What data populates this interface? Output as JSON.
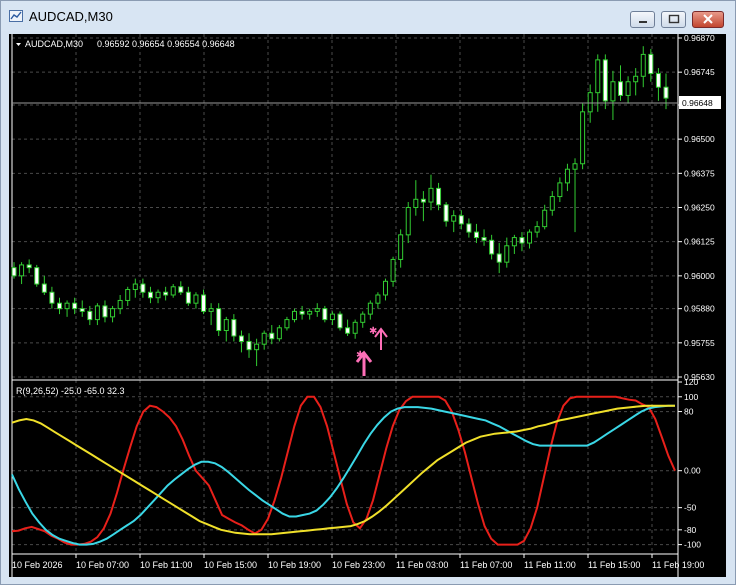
{
  "window": {
    "title": "AUDCAD,M30"
  },
  "colors": {
    "background": "#000000",
    "grid": "#4a4a4a",
    "candle": "#32cd32",
    "text": "#ffffff",
    "red_line": "#e8201a",
    "cyan_line": "#3ad7e6",
    "yellow_line": "#f0e02a",
    "arrow": "#ff6fb8"
  },
  "main_chart": {
    "symbol_label": "AUDCAD,M30",
    "ohlc_label": "0.96592 0.96654 0.96554 0.96648",
    "current_price": "0.96648",
    "price_ticks": [
      "0.96870",
      "0.96745",
      "0.96625",
      "0.96500",
      "0.96375",
      "0.96250",
      "0.96125",
      "0.96000",
      "0.95880",
      "0.95755",
      "0.95630"
    ]
  },
  "indicator": {
    "label": "R(9,26,52) -25.0 -65.0 32.3",
    "ticks": [
      "120",
      "100",
      "80",
      "0.00",
      "-50",
      "-80",
      "-100"
    ]
  },
  "time_axis": [
    "10 Feb 2026",
    "10 Feb 07:00",
    "10 Feb 11:00",
    "10 Feb 15:00",
    "10 Feb 19:00",
    "10 Feb 23:00",
    "11 Feb 03:00",
    "11 Feb 07:00",
    "11 Feb 11:00",
    "11 Feb 15:00",
    "11 Feb 19:00"
  ],
  "chart_data": {
    "type": "line",
    "title": "AUDCAD,M30",
    "ylim": [
      0.9563,
      0.9687
    ],
    "candles": [
      [
        0.9603,
        0.9605,
        0.9599,
        0.96
      ],
      [
        0.96,
        0.9605,
        0.9597,
        0.9604
      ],
      [
        0.9604,
        0.9606,
        0.9601,
        0.9603
      ],
      [
        0.9603,
        0.9604,
        0.9596,
        0.9597
      ],
      [
        0.9597,
        0.96,
        0.9593,
        0.9594
      ],
      [
        0.9594,
        0.9596,
        0.9588,
        0.959
      ],
      [
        0.959,
        0.9592,
        0.9586,
        0.9588
      ],
      [
        0.9588,
        0.9591,
        0.9585,
        0.959
      ],
      [
        0.959,
        0.9592,
        0.9586,
        0.9588
      ],
      [
        0.9588,
        0.9591,
        0.9585,
        0.9587
      ],
      [
        0.9587,
        0.9589,
        0.9582,
        0.9584
      ],
      [
        0.9584,
        0.959,
        0.9582,
        0.9589
      ],
      [
        0.9589,
        0.9591,
        0.9583,
        0.9585
      ],
      [
        0.9585,
        0.9589,
        0.9583,
        0.9588
      ],
      [
        0.9588,
        0.9593,
        0.9586,
        0.9591
      ],
      [
        0.9591,
        0.9596,
        0.9589,
        0.9595
      ],
      [
        0.9595,
        0.9599,
        0.9592,
        0.9597
      ],
      [
        0.9597,
        0.9599,
        0.9592,
        0.9594
      ],
      [
        0.9594,
        0.9596,
        0.959,
        0.9592
      ],
      [
        0.9592,
        0.9595,
        0.959,
        0.9594
      ],
      [
        0.9594,
        0.9596,
        0.9591,
        0.9593
      ],
      [
        0.9593,
        0.9597,
        0.9592,
        0.9596
      ],
      [
        0.9596,
        0.9598,
        0.9593,
        0.9594
      ],
      [
        0.9594,
        0.9596,
        0.9589,
        0.959
      ],
      [
        0.959,
        0.9594,
        0.9588,
        0.9593
      ],
      [
        0.9593,
        0.9595,
        0.9586,
        0.9587
      ],
      [
        0.9587,
        0.959,
        0.9582,
        0.9588
      ],
      [
        0.9588,
        0.959,
        0.9578,
        0.958
      ],
      [
        0.958,
        0.9585,
        0.9576,
        0.9584
      ],
      [
        0.9584,
        0.9586,
        0.9576,
        0.9578
      ],
      [
        0.9578,
        0.958,
        0.9572,
        0.9576
      ],
      [
        0.9576,
        0.9579,
        0.957,
        0.9573
      ],
      [
        0.9573,
        0.9577,
        0.9567,
        0.9575
      ],
      [
        0.9575,
        0.958,
        0.9573,
        0.9579
      ],
      [
        0.9579,
        0.9582,
        0.9575,
        0.9577
      ],
      [
        0.9577,
        0.9582,
        0.9576,
        0.9581
      ],
      [
        0.9581,
        0.9585,
        0.958,
        0.9584
      ],
      [
        0.9584,
        0.9588,
        0.9583,
        0.9587
      ],
      [
        0.9587,
        0.9589,
        0.9584,
        0.9586
      ],
      [
        0.9586,
        0.9588,
        0.9584,
        0.9587
      ],
      [
        0.9587,
        0.959,
        0.9585,
        0.9588
      ],
      [
        0.9588,
        0.9589,
        0.9583,
        0.9584
      ],
      [
        0.9584,
        0.9587,
        0.9582,
        0.9586
      ],
      [
        0.9586,
        0.9587,
        0.958,
        0.9581
      ],
      [
        0.9581,
        0.9584,
        0.9578,
        0.9579
      ],
      [
        0.9579,
        0.9584,
        0.9577,
        0.9583
      ],
      [
        0.9583,
        0.9587,
        0.9581,
        0.9586
      ],
      [
        0.9586,
        0.9591,
        0.9584,
        0.959
      ],
      [
        0.959,
        0.9594,
        0.9588,
        0.9593
      ],
      [
        0.9593,
        0.9599,
        0.9591,
        0.9598
      ],
      [
        0.9598,
        0.9607,
        0.9596,
        0.9606
      ],
      [
        0.9606,
        0.9617,
        0.9603,
        0.9615
      ],
      [
        0.9615,
        0.9627,
        0.9612,
        0.9625
      ],
      [
        0.9625,
        0.9635,
        0.9622,
        0.9628
      ],
      [
        0.9628,
        0.9631,
        0.962,
        0.9627
      ],
      [
        0.9627,
        0.9637,
        0.9624,
        0.9632
      ],
      [
        0.9632,
        0.9634,
        0.9624,
        0.9626
      ],
      [
        0.9626,
        0.9627,
        0.9618,
        0.962
      ],
      [
        0.962,
        0.9624,
        0.9616,
        0.9622
      ],
      [
        0.9622,
        0.9624,
        0.9617,
        0.9619
      ],
      [
        0.9619,
        0.9621,
        0.9614,
        0.9616
      ],
      [
        0.9616,
        0.9619,
        0.9612,
        0.9614
      ],
      [
        0.9614,
        0.9617,
        0.9611,
        0.9613
      ],
      [
        0.9613,
        0.9615,
        0.9606,
        0.9608
      ],
      [
        0.9608,
        0.9612,
        0.9601,
        0.9605
      ],
      [
        0.9605,
        0.9614,
        0.9603,
        0.9611
      ],
      [
        0.9611,
        0.9615,
        0.9608,
        0.9614
      ],
      [
        0.9614,
        0.9616,
        0.9609,
        0.9612
      ],
      [
        0.9612,
        0.9617,
        0.961,
        0.9616
      ],
      [
        0.9616,
        0.962,
        0.9614,
        0.9618
      ],
      [
        0.9618,
        0.9626,
        0.9617,
        0.9624
      ],
      [
        0.9624,
        0.9631,
        0.9622,
        0.9629
      ],
      [
        0.9629,
        0.9636,
        0.9627,
        0.9634
      ],
      [
        0.9634,
        0.9641,
        0.9631,
        0.9639
      ],
      [
        0.9639,
        0.9643,
        0.9616,
        0.9641
      ],
      [
        0.9641,
        0.9663,
        0.9639,
        0.966
      ],
      [
        0.966,
        0.967,
        0.9656,
        0.9667
      ],
      [
        0.9667,
        0.9681,
        0.966,
        0.9679
      ],
      [
        0.9679,
        0.9681,
        0.9661,
        0.9664
      ],
      [
        0.9664,
        0.9675,
        0.9657,
        0.9671
      ],
      [
        0.9671,
        0.9677,
        0.9664,
        0.9666
      ],
      [
        0.9666,
        0.9673,
        0.9663,
        0.9671
      ],
      [
        0.9671,
        0.9676,
        0.9666,
        0.9673
      ],
      [
        0.9673,
        0.9684,
        0.9669,
        0.9681
      ],
      [
        0.9681,
        0.9683,
        0.9671,
        0.9674
      ],
      [
        0.9674,
        0.9676,
        0.9664,
        0.9669
      ],
      [
        0.9669,
        0.9674,
        0.9661,
        0.9665
      ]
    ],
    "indicator_ylim": [
      -110,
      120
    ],
    "series": [
      {
        "color": "red",
        "values": [
          -82,
          -81,
          -78,
          -76,
          -79,
          -82,
          -88,
          -92,
          -97,
          -100,
          -100,
          -99,
          -96,
          -90,
          -78,
          -58,
          -30,
          2,
          32,
          60,
          80,
          88,
          86,
          80,
          72,
          60,
          42,
          20,
          0,
          -10,
          -20,
          -40,
          -60,
          -65,
          -70,
          -74,
          -80,
          -85,
          -80,
          -65,
          -40,
          -10,
          25,
          60,
          88,
          100,
          100,
          86,
          60,
          25,
          -10,
          -45,
          -70,
          -78,
          -65,
          -40,
          -5,
          30,
          60,
          82,
          94,
          100,
          100,
          100,
          100,
          100,
          95,
          80,
          55,
          25,
          -10,
          -45,
          -75,
          -92,
          -100,
          -100,
          -100,
          -100,
          -95,
          -78,
          -50,
          -10,
          30,
          65,
          88,
          98,
          100,
          100,
          100,
          100,
          100,
          100,
          100,
          98,
          96,
          95,
          90,
          86,
          70,
          45,
          20,
          0
        ]
      },
      {
        "color": "cyan",
        "values": [
          -5,
          -25,
          -42,
          -58,
          -70,
          -80,
          -87,
          -92,
          -95,
          -98,
          -100,
          -100,
          -99,
          -96,
          -92,
          -86,
          -80,
          -74,
          -68,
          -60,
          -50,
          -40,
          -30,
          -20,
          -12,
          -5,
          2,
          8,
          12,
          12,
          10,
          5,
          -2,
          -10,
          -18,
          -26,
          -33,
          -40,
          -46,
          -52,
          -58,
          -62,
          -62,
          -60,
          -58,
          -54,
          -46,
          -36,
          -24,
          -10,
          5,
          20,
          36,
          50,
          62,
          72,
          80,
          84,
          86,
          86,
          86,
          85,
          84,
          82,
          80,
          78,
          76,
          74,
          72,
          70,
          68,
          64,
          60,
          55,
          50,
          45,
          40,
          36,
          34,
          34,
          34,
          34,
          34,
          34,
          34,
          34,
          38,
          44,
          50,
          56,
          62,
          68,
          74,
          80,
          84,
          86,
          87,
          88,
          88
        ]
      },
      {
        "color": "yellow",
        "values": [
          65,
          68,
          70,
          68,
          64,
          58,
          52,
          46,
          40,
          34,
          28,
          22,
          16,
          10,
          4,
          -2,
          -8,
          -14,
          -20,
          -26,
          -32,
          -38,
          -44,
          -50,
          -56,
          -62,
          -68,
          -72,
          -76,
          -80,
          -82,
          -84,
          -85,
          -86,
          -86,
          -86,
          -86,
          -85,
          -84,
          -83,
          -82,
          -81,
          -80,
          -79,
          -78,
          -77,
          -76,
          -75,
          -72,
          -68,
          -62,
          -55,
          -47,
          -38,
          -29,
          -20,
          -11,
          -2,
          6,
          14,
          20,
          26,
          32,
          38,
          42,
          46,
          48,
          50,
          51,
          52,
          53,
          55,
          57,
          60,
          62,
          65,
          68,
          70,
          72,
          74,
          76,
          78,
          80,
          82,
          84,
          85,
          86,
          87,
          88,
          88,
          88,
          88,
          88
        ]
      }
    ]
  }
}
